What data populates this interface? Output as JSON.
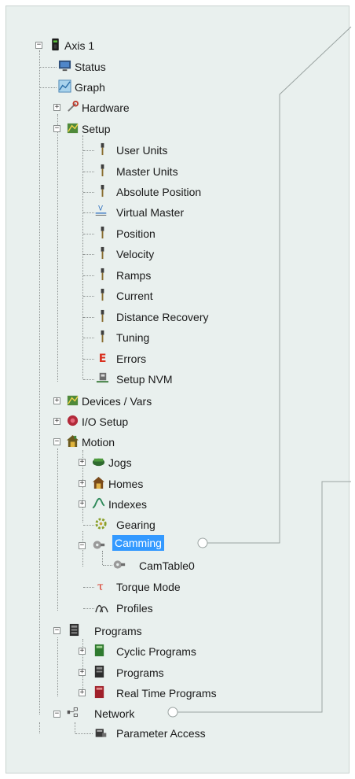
{
  "tree": {
    "axis": "Axis 1",
    "status": "Status",
    "graph": "Graph",
    "hardware": "Hardware",
    "setup": "Setup",
    "user_units": "User Units",
    "master_units": "Master Units",
    "absolute_position": "Absolute Position",
    "virtual_master": "Virtual Master",
    "position": "Position",
    "velocity": "Velocity",
    "ramps": "Ramps",
    "current": "Current",
    "distance_recovery": "Distance Recovery",
    "tuning": "Tuning",
    "errors": "Errors",
    "setup_nvm": "Setup NVM",
    "devices_vars": "Devices / Vars",
    "io_setup": "I/O Setup",
    "motion": "Motion",
    "jogs": "Jogs",
    "homes": "Homes",
    "indexes": "Indexes",
    "gearing": "Gearing",
    "camming": "Camming",
    "camtable0": "CamTable0",
    "torque_mode": "Torque Mode",
    "profiles": "Profiles",
    "programs": "Programs",
    "cyclic_programs": "Cyclic Programs",
    "programs_sub": "Programs",
    "real_time_programs": "Real Time Programs",
    "network": "Network",
    "parameter_access": "Parameter Access"
  },
  "expanders": {
    "plus": "+",
    "minus": "−"
  },
  "icons": {
    "axis": "axis-drive-icon",
    "status": "monitor-icon",
    "graph": "graph-icon",
    "hardware": "tools-icon",
    "setup": "setup-icon",
    "param": "parameter-probe-icon",
    "virtual_master": "virtual-master-icon",
    "errors": "error-e-icon",
    "nvm": "nvm-save-icon",
    "devices": "devices-icon",
    "io": "io-icon",
    "motion": "motion-icon",
    "jogs": "jogs-icon",
    "homes": "home-icon",
    "indexes": "index-curve-icon",
    "gearing": "gear-icon",
    "camming": "cam-icon",
    "camtable": "cam-table-icon",
    "torque": "torque-icon",
    "profiles": "profiles-icon",
    "programs": "program-icon",
    "network": "network-icon",
    "parameter_access": "parameter-access-icon"
  },
  "colors": {
    "selection": "#3399ff",
    "panel": "#e9f0ee",
    "connector": "#8a8f8e"
  }
}
